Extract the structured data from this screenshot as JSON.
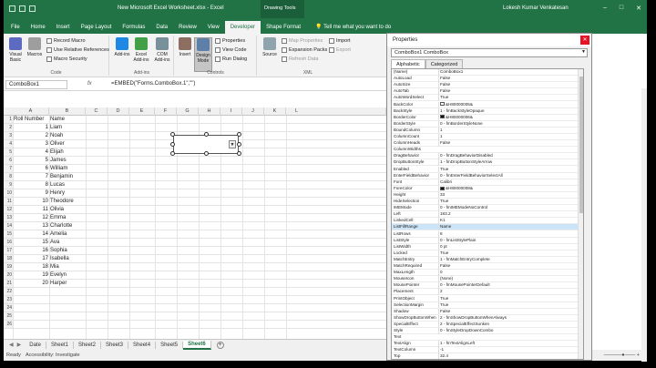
{
  "titlebar": {
    "doc_title": "New Microsoft Excel Worksheet.xlsx - Excel",
    "context_tab": "Drawing Tools",
    "user": "Lokesh Kumar Venkatesan",
    "win_controls": [
      "–",
      "□",
      "✕"
    ]
  },
  "tabs": {
    "items": [
      "File",
      "Home",
      "Insert",
      "Page Layout",
      "Formulas",
      "Data",
      "Review",
      "View",
      "Developer",
      "Shape Format"
    ],
    "active": "Developer",
    "tell_me": "Tell me what you want to do"
  },
  "ribbon": {
    "code": {
      "label": "Code",
      "visual_basic": "Visual Basic",
      "macros": "Macros",
      "record_macro": "Record Macro",
      "use_relative": "Use Relative References",
      "macro_security": "Macro Security"
    },
    "addins": {
      "label": "Add-ins",
      "add_ins": "Add-ins",
      "excel_addins": "Excel Add-ins",
      "com_addins": "COM Add-ins"
    },
    "controls": {
      "label": "Controls",
      "insert": "Insert",
      "design_mode": "Design Mode",
      "properties": "Properties",
      "view_code": "View Code",
      "run_dialog": "Run Dialog"
    },
    "xml": {
      "label": "XML",
      "source": "Source",
      "map_properties": "Map Properties",
      "expansion_packs": "Expansion Packs",
      "refresh_data": "Refresh Data",
      "import": "Import",
      "export": "Export"
    }
  },
  "formula_bar": {
    "name_box": "ComboBox1",
    "fx": "fx",
    "formula": "=EMBED(\"Forms.ComboBox.1\",\"\")"
  },
  "grid": {
    "columns": [
      "A",
      "B",
      "C",
      "D",
      "E",
      "F",
      "G",
      "H",
      "I",
      "J",
      "K",
      "L"
    ],
    "header_row": {
      "a": "Roll Number",
      "b": "Name"
    },
    "rows": [
      {
        "n": "1",
        "a": "1",
        "b": "Liam"
      },
      {
        "n": "2",
        "a": "2",
        "b": "Noah"
      },
      {
        "n": "3",
        "a": "3",
        "b": "Oliver"
      },
      {
        "n": "4",
        "a": "4",
        "b": "Elijah"
      },
      {
        "n": "5",
        "a": "5",
        "b": "James"
      },
      {
        "n": "6",
        "a": "6",
        "b": "William"
      },
      {
        "n": "7",
        "a": "7",
        "b": "Benjamin"
      },
      {
        "n": "8",
        "a": "8",
        "b": "Lucas"
      },
      {
        "n": "9",
        "a": "9",
        "b": "Henry"
      },
      {
        "n": "10",
        "a": "10",
        "b": "Theodore"
      },
      {
        "n": "11",
        "a": "11",
        "b": "Olivia"
      },
      {
        "n": "12",
        "a": "12",
        "b": "Emma"
      },
      {
        "n": "13",
        "a": "13",
        "b": "Charlotte"
      },
      {
        "n": "14",
        "a": "14",
        "b": "Amelia"
      },
      {
        "n": "15",
        "a": "15",
        "b": "Ava"
      },
      {
        "n": "16",
        "a": "16",
        "b": "Sophia"
      },
      {
        "n": "17",
        "a": "17",
        "b": "Isabella"
      },
      {
        "n": "18",
        "a": "18",
        "b": "Mia"
      },
      {
        "n": "19",
        "a": "19",
        "b": "Evelyn"
      },
      {
        "n": "20",
        "a": "20",
        "b": "Harper"
      }
    ],
    "row_numbers": [
      "1",
      "2",
      "3",
      "4",
      "5",
      "6",
      "7",
      "8",
      "9",
      "10",
      "11",
      "12",
      "13",
      "14",
      "15",
      "16",
      "17",
      "18",
      "19",
      "20",
      "21",
      "22",
      "23",
      "24",
      "25",
      "26"
    ]
  },
  "sheet_tabs": {
    "items": [
      "Date",
      "Sheet1",
      "Sheet2",
      "Sheet3",
      "Sheet4",
      "Sheet5",
      "Sheet6"
    ],
    "active": "Sheet6"
  },
  "status": {
    "ready": "Ready",
    "accessibility": "Accessibility: Investigate"
  },
  "properties": {
    "title": "Properties",
    "object": "ComboBox1 ComboBox",
    "tabs": [
      "Alphabetic",
      "Categorized"
    ],
    "active_tab": "Alphabetic",
    "rows": [
      {
        "name": "(Name)",
        "value": "ComboBox1"
      },
      {
        "name": "AutoLoad",
        "value": "False"
      },
      {
        "name": "AutoSize",
        "value": "False"
      },
      {
        "name": "AutoTab",
        "value": "False"
      },
      {
        "name": "AutoWordSelect",
        "value": "True"
      },
      {
        "name": "BackColor",
        "value": "&H80000005&",
        "swatch": "#ffffff"
      },
      {
        "name": "BackStyle",
        "value": "1 - fmBackStyleOpaque"
      },
      {
        "name": "BorderColor",
        "value": "&H80000006&",
        "swatch": "#111111"
      },
      {
        "name": "BorderStyle",
        "value": "0 - fmBorderStyleNone"
      },
      {
        "name": "BoundColumn",
        "value": "1"
      },
      {
        "name": "ColumnCount",
        "value": "1"
      },
      {
        "name": "ColumnHeads",
        "value": "False"
      },
      {
        "name": "ColumnWidths",
        "value": ""
      },
      {
        "name": "DragBehavior",
        "value": "0 - fmDragBehaviorDisabled"
      },
      {
        "name": "DropButtonStyle",
        "value": "1 - fmDropButtonStyleArrow"
      },
      {
        "name": "Enabled",
        "value": "True"
      },
      {
        "name": "EnterFieldBehavior",
        "value": "0 - fmEnterFieldBehaviorSelectAll"
      },
      {
        "name": "Font",
        "value": "Calibri"
      },
      {
        "name": "ForeColor",
        "value": "&H80000008&",
        "swatch": "#111111"
      },
      {
        "name": "Height",
        "value": "33"
      },
      {
        "name": "HideSelection",
        "value": "True"
      },
      {
        "name": "IMEMode",
        "value": "0 - fmIMEModeNoControl"
      },
      {
        "name": "Left",
        "value": "183.2"
      },
      {
        "name": "LinkedCell",
        "value": "K1"
      },
      {
        "name": "ListFillRange",
        "value": "Name",
        "selected": true
      },
      {
        "name": "ListRows",
        "value": "8"
      },
      {
        "name": "ListStyle",
        "value": "0 - fmListStylePlain"
      },
      {
        "name": "ListWidth",
        "value": "0 pt"
      },
      {
        "name": "Locked",
        "value": "True"
      },
      {
        "name": "MatchEntry",
        "value": "1 - fmMatchEntryComplete"
      },
      {
        "name": "MatchRequired",
        "value": "False"
      },
      {
        "name": "MaxLength",
        "value": "0"
      },
      {
        "name": "MouseIcon",
        "value": "(None)"
      },
      {
        "name": "MousePointer",
        "value": "0 - fmMousePointerDefault"
      },
      {
        "name": "Placement",
        "value": "2"
      },
      {
        "name": "PrintObject",
        "value": "True"
      },
      {
        "name": "SelectionMargin",
        "value": "True"
      },
      {
        "name": "Shadow",
        "value": "False"
      },
      {
        "name": "ShowDropButtonWhen",
        "value": "2 - fmShowDropButtonWhenAlways"
      },
      {
        "name": "SpecialEffect",
        "value": "2 - fmSpecialEffectSunken"
      },
      {
        "name": "Style",
        "value": "0 - fmStyleDropDownCombo"
      },
      {
        "name": "Text",
        "value": ""
      },
      {
        "name": "TextAlign",
        "value": "1 - fmTextAlignLeft"
      },
      {
        "name": "TextColumn",
        "value": "-1"
      },
      {
        "name": "Top",
        "value": "32.4"
      }
    ]
  },
  "colors": {
    "excel_green": "#217346",
    "selection_blue": "#cce4f7"
  }
}
